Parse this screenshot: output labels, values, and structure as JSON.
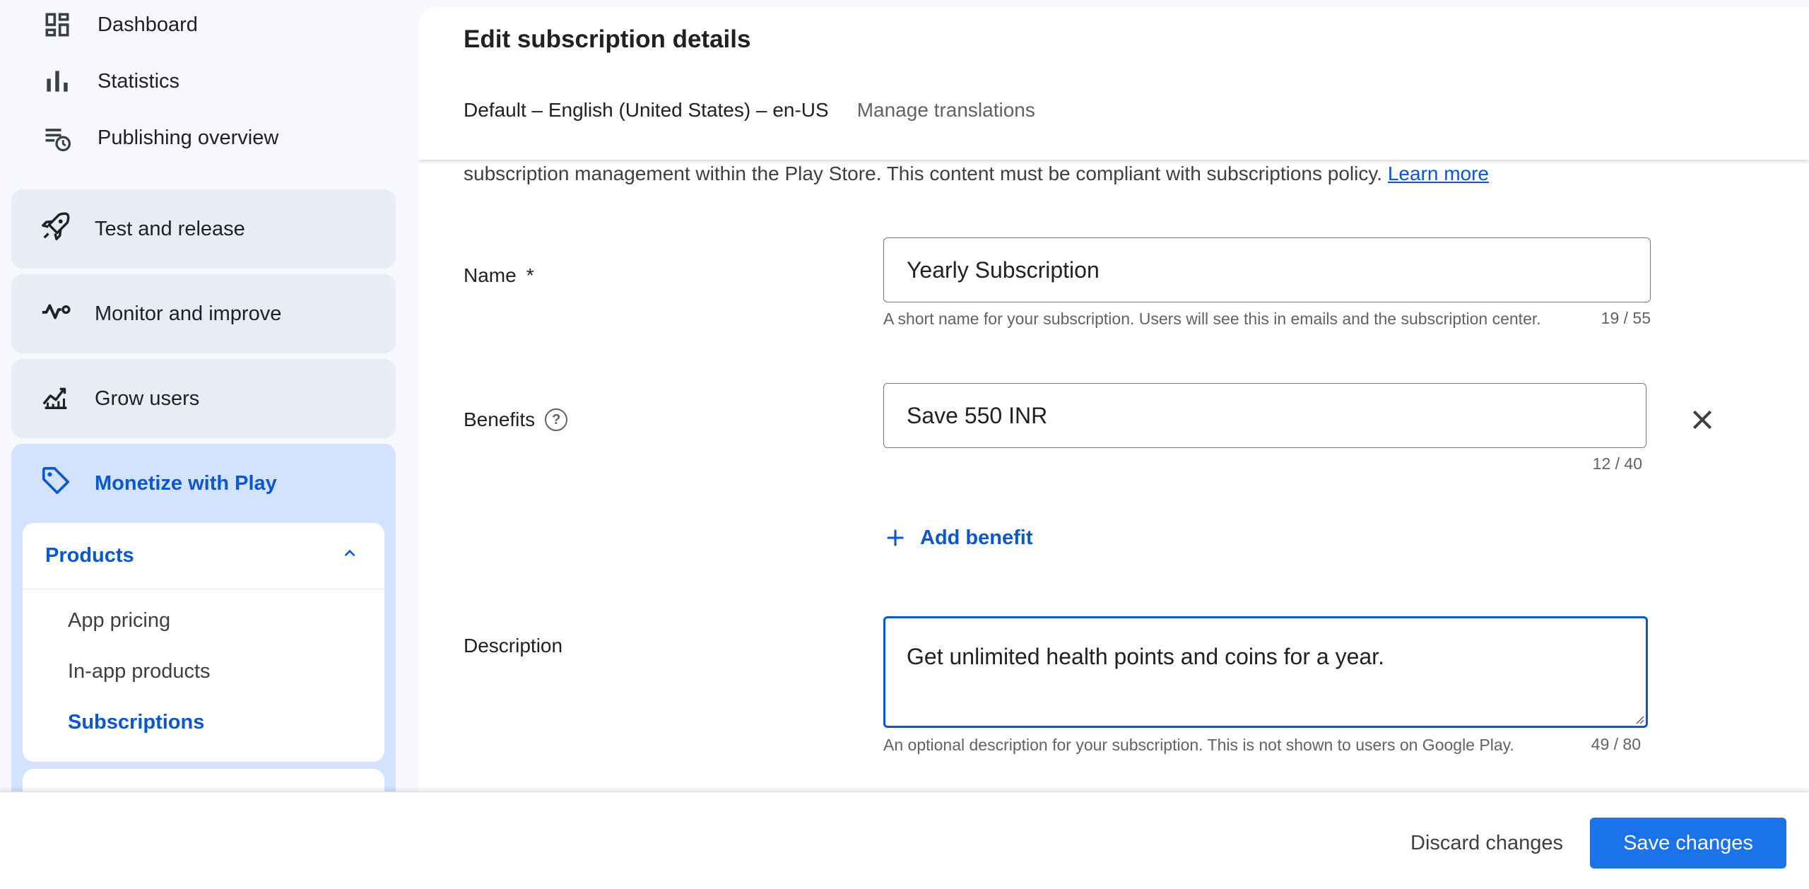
{
  "sidebar": {
    "top_items": [
      {
        "label": "Dashboard",
        "icon": "dashboard-icon"
      },
      {
        "label": "Statistics",
        "icon": "bar-chart-icon"
      },
      {
        "label": "Publishing overview",
        "icon": "publishing-history-icon"
      }
    ],
    "sections": [
      {
        "label": "Test and release",
        "icon": "rocket-icon"
      },
      {
        "label": "Monitor and improve",
        "icon": "vitals-icon"
      },
      {
        "label": "Grow users",
        "icon": "trending-icon"
      }
    ],
    "monetize": {
      "label": "Monetize with Play",
      "icon": "tag-icon",
      "group_label": "Products",
      "items": [
        {
          "label": "App pricing",
          "active": false
        },
        {
          "label": "In-app products",
          "active": false
        },
        {
          "label": "Subscriptions",
          "active": true
        }
      ]
    }
  },
  "main": {
    "title": "Edit subscription details",
    "language_default": "Default – English (United States) – en-US",
    "manage_translations": "Manage translations",
    "intro_text": "subscription management within the Play Store. This content must be compliant with subscriptions policy.",
    "learn_more": "Learn more",
    "name_field": {
      "label": "Name",
      "required_mark": "*",
      "value": "Yearly Subscription",
      "helper": "A short name for your subscription. Users will see this in emails and the subscription center.",
      "counter": "19 / 55"
    },
    "benefits_field": {
      "label": "Benefits",
      "help_icon": "help-circle-icon",
      "value": "Save 550 INR",
      "counter": "12 / 40",
      "add_label": "Add benefit"
    },
    "description_field": {
      "label": "Description",
      "value": "Get unlimited health points and coins for a year.",
      "helper": "An optional description for your subscription. This is not shown to users on Google Play.",
      "counter": "49 / 80"
    }
  },
  "footer": {
    "discard_label": "Discard changes",
    "save_label": "Save changes"
  },
  "colors": {
    "accent": "#0b57d0",
    "primary_button": "#1a73e8",
    "active_nav_bg": "#d3e3fd",
    "nav_card_bg": "#e8ecf4"
  }
}
